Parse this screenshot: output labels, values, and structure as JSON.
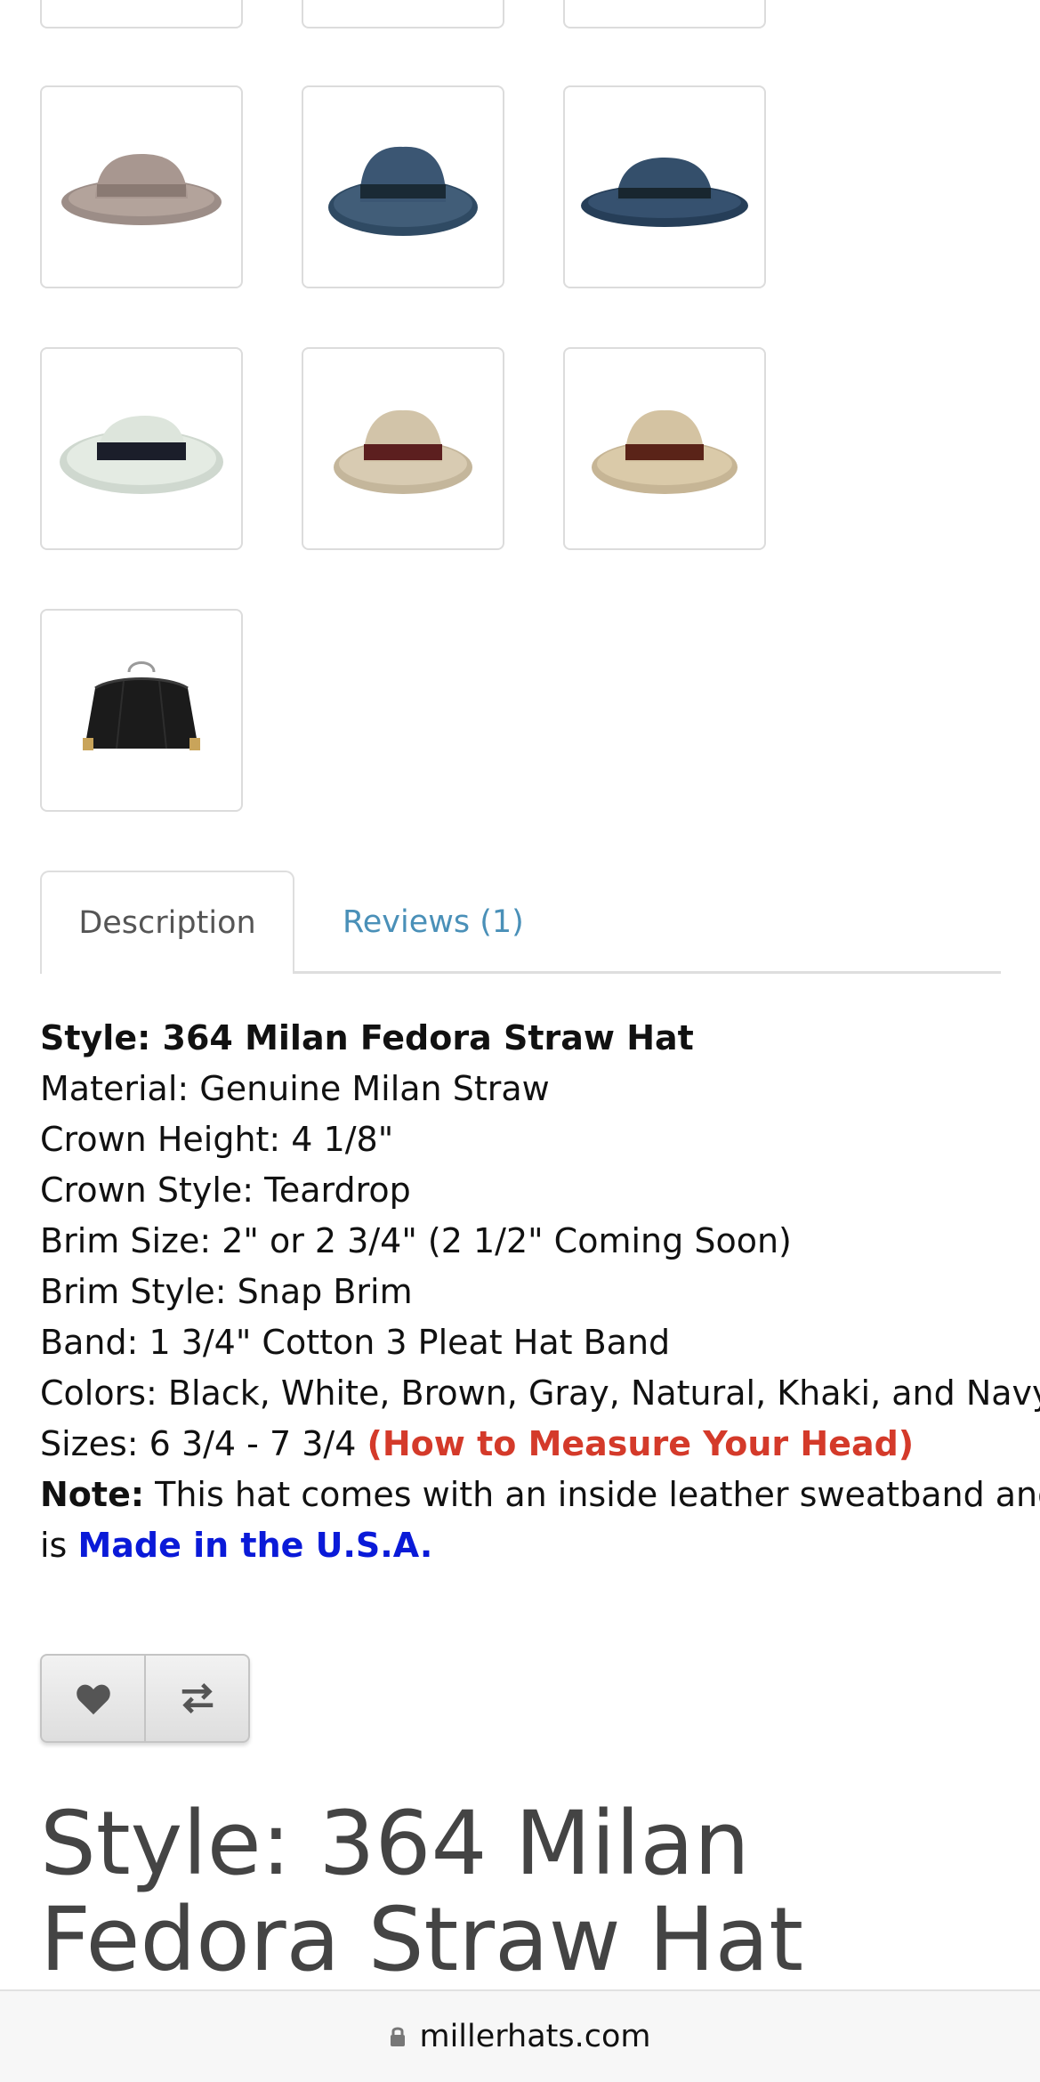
{
  "gallery": [
    {
      "name": "fedora-taupe",
      "alt": "taupe fedora"
    },
    {
      "name": "fedora-blue-teardrop",
      "alt": "blue fedora"
    },
    {
      "name": "fedora-navy",
      "alt": "navy fedora"
    },
    {
      "name": "fedora-white-black-band",
      "alt": "white fedora"
    },
    {
      "name": "fedora-natural-brown-band",
      "alt": "natural fedora"
    },
    {
      "name": "fedora-khaki-brown-band",
      "alt": "khaki fedora"
    },
    {
      "name": "hat-box",
      "alt": "hat box"
    }
  ],
  "tabs": {
    "description": "Description",
    "reviews": "Reviews (1)"
  },
  "description": {
    "style_line": "Style: 364 Milan Fedora Straw Hat",
    "material": "Material: Genuine Milan Straw",
    "crown_height": "Crown Height: 4 1/8\"",
    "crown_style": "Crown Style: Teardrop",
    "brim_size": "Brim Size: 2\" or 2 3/4\" (2 1/2\" Coming Soon)",
    "brim_style": "Brim Style: Snap Brim",
    "band": "Band: 1 3/4\" Cotton 3 Pleat Hat Band",
    "colors": "Colors: Black, White, Brown, Gray, Natural, Khaki, and Navy",
    "sizes_prefix": "Sizes: 6 3/4 - 7 3/4 ",
    "measure_link": "(How to Measure Your Head)",
    "note_label": "Note:",
    "note_text": " This hat comes with an inside leather sweatband and",
    "note_is": "is ",
    "made_in": "Made in the U.S.A."
  },
  "actions": {
    "wishlist_icon": "heart-icon",
    "compare_icon": "compare-arrows-icon"
  },
  "product_title": "Style: 364 Milan Fedora Straw Hat",
  "browser": {
    "domain": "millerhats.com"
  },
  "colors": {
    "link_blue": "#4a90b8",
    "measure_red": "#d43a2a",
    "usa_blue": "#0a1ad8"
  }
}
